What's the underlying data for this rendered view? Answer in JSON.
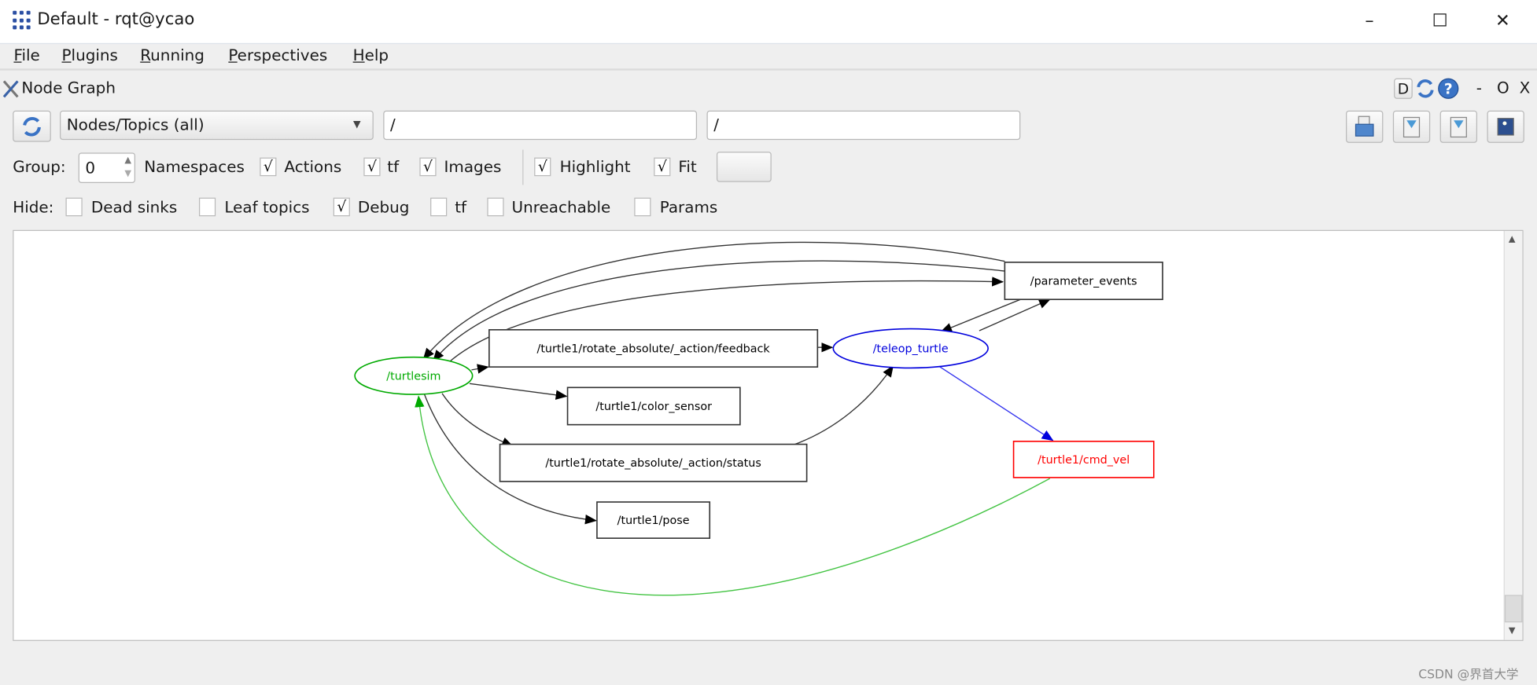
{
  "window": {
    "title": "Default - rqt@ycao",
    "minimize": "–",
    "maximize": "☐",
    "close": "✕"
  },
  "menu": [
    {
      "label": "File",
      "mnemonic": "F",
      "rest": "ile"
    },
    {
      "label": "Plugins",
      "mnemonic": "P",
      "rest": "lugins"
    },
    {
      "label": "Running",
      "mnemonic": "R",
      "rest": "unning"
    },
    {
      "label": "Perspectives",
      "mnemonic": "P",
      "rest": "erspectives",
      "pre": ""
    },
    {
      "label": "Help",
      "mnemonic": "H",
      "rest": "elp"
    }
  ],
  "plugin": {
    "title": "Node Graph",
    "d_button": "D",
    "dash": "-",
    "o": "O",
    "x": "X"
  },
  "toolbar": {
    "graph_type": "Nodes/Topics (all)",
    "node_filter": "/",
    "topic_filter": "/"
  },
  "options": {
    "group_label": "Group:",
    "group_value": "0",
    "namespaces_label": "Namespaces",
    "checks": [
      {
        "label": "Actions",
        "checked": true
      },
      {
        "label": "tf",
        "checked": true
      },
      {
        "label": "Images",
        "checked": true
      },
      {
        "label": "Highlight",
        "checked": true
      },
      {
        "label": "Fit",
        "checked": true
      }
    ]
  },
  "hide": {
    "label": "Hide:",
    "checks": [
      {
        "label": "Dead sinks",
        "checked": false
      },
      {
        "label": "Leaf topics",
        "checked": false
      },
      {
        "label": "Debug",
        "checked": true
      },
      {
        "label": "tf",
        "checked": false
      },
      {
        "label": "Unreachable",
        "checked": false
      },
      {
        "label": "Params",
        "checked": false
      }
    ]
  },
  "graph": {
    "nodes": [
      {
        "id": "turtlesim",
        "label": "/turtlesim",
        "kind": "node",
        "color": "#00aa00"
      },
      {
        "id": "teleop",
        "label": "/teleop_turtle",
        "kind": "node",
        "color": "#0000dd"
      },
      {
        "id": "feedback",
        "label": "/turtle1/rotate_absolute/_action/feedback",
        "kind": "topic",
        "color": "#000000"
      },
      {
        "id": "color_sensor",
        "label": "/turtle1/color_sensor",
        "kind": "topic",
        "color": "#000000"
      },
      {
        "id": "status",
        "label": "/turtle1/rotate_absolute/_action/status",
        "kind": "topic",
        "color": "#000000"
      },
      {
        "id": "pose",
        "label": "/turtle1/pose",
        "kind": "topic",
        "color": "#000000"
      },
      {
        "id": "param_events",
        "label": "/parameter_events",
        "kind": "topic",
        "color": "#000000"
      },
      {
        "id": "cmd_vel",
        "label": "/turtle1/cmd_vel",
        "kind": "topic",
        "color": "#ff0000"
      }
    ],
    "edges": [
      {
        "from": "param_events",
        "to": "turtlesim"
      },
      {
        "from": "param_events",
        "to": "turtlesim"
      },
      {
        "from": "turtlesim",
        "to": "param_events"
      },
      {
        "from": "turtlesim",
        "to": "feedback"
      },
      {
        "from": "feedback",
        "to": "teleop"
      },
      {
        "from": "turtlesim",
        "to": "color_sensor"
      },
      {
        "from": "turtlesim",
        "to": "status"
      },
      {
        "from": "status",
        "to": "teleop"
      },
      {
        "from": "turtlesim",
        "to": "pose"
      },
      {
        "from": "teleop",
        "to": "param_events"
      },
      {
        "from": "param_events",
        "to": "teleop"
      },
      {
        "from": "teleop",
        "to": "cmd_vel",
        "color": "#0000ff"
      },
      {
        "from": "cmd_vel",
        "to": "turtlesim",
        "color": "#33bb33"
      }
    ]
  },
  "watermark": "CSDN @界首大学"
}
